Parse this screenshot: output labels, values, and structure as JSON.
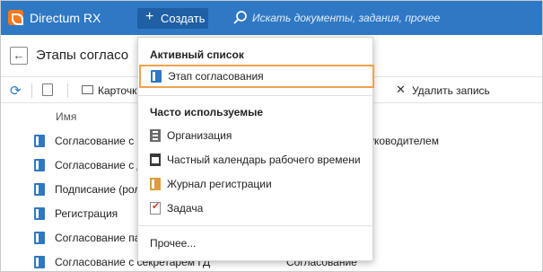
{
  "header": {
    "app_title": "Directum RX",
    "create_button": "Создать",
    "search_placeholder": "Искать документы, задания, прочее"
  },
  "page": {
    "title": "Этапы согласо"
  },
  "toolbar": {
    "card_label": "Карточка",
    "delete_label": "Удалить запись"
  },
  "table": {
    "column_name": "Имя",
    "rows": [
      {
        "name": "Согласование с р",
        "type": "уководителем"
      },
      {
        "name": "Согласование с д",
        "type": ""
      },
      {
        "name": "Подписание (рол",
        "type": ""
      },
      {
        "name": "Регистрация",
        "type": ""
      },
      {
        "name": "Согласование па",
        "type": ""
      },
      {
        "name": "Согласование с секретарем ГД",
        "type": "Согласование"
      }
    ]
  },
  "dropdown": {
    "active_heading": "Активный список",
    "active_item": "Этап согласования",
    "frequent_heading": "Часто используемые",
    "frequent_items": [
      {
        "label": "Организация",
        "icon": "organization-icon"
      },
      {
        "label": "Частный календарь рабочего времени",
        "icon": "calendar-icon"
      },
      {
        "label": "Журнал регистрации",
        "icon": "journal-icon"
      },
      {
        "label": "Задача",
        "icon": "task-icon"
      }
    ],
    "more": "Прочее..."
  },
  "colors": {
    "brand": "#2f78c4",
    "logo": "#f47a20",
    "highlight": "#f0a24b"
  }
}
